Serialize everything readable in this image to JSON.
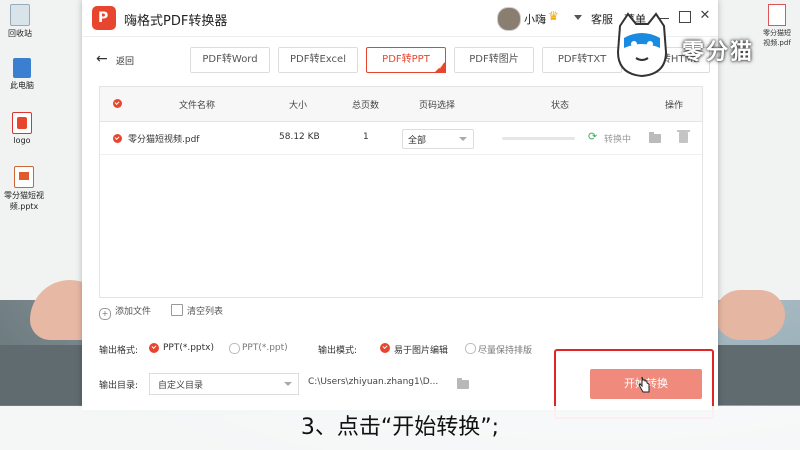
{
  "desktop": {
    "icons": [
      {
        "label": "回收站"
      },
      {
        "label": "此电脑"
      },
      {
        "label": "logo"
      },
      {
        "label": "零分猫短视频.pptx"
      }
    ],
    "pdf_file_label": "零分猫短视频.pdf"
  },
  "app": {
    "title": "嗨格式PDF转换器",
    "username": "小嗨",
    "service": "客服",
    "menu": "菜单",
    "back_label": "返回",
    "tabs": [
      {
        "label": "PDF转Word",
        "active": false
      },
      {
        "label": "PDF转Excel",
        "active": false
      },
      {
        "label": "PDF转PPT",
        "active": true
      },
      {
        "label": "PDF转图片",
        "active": false
      },
      {
        "label": "PDF转TXT",
        "active": false
      },
      {
        "label": "PDF转HTML",
        "active": false
      }
    ],
    "table": {
      "headers": {
        "name": "文件名称",
        "size": "大小",
        "pages": "总页数",
        "page_select": "页码选择",
        "status": "状态",
        "action": "操作"
      },
      "rows": [
        {
          "name": "零分猫短视频.pdf",
          "size": "58.12 KB",
          "pages": "1",
          "page_select": "全部",
          "progress": 0.0,
          "status": "转换中"
        }
      ]
    },
    "add_file": "添加文件",
    "clear_list": "清空列表",
    "output_format_label": "输出格式:",
    "format_options": [
      {
        "label": "PPT(*.pptx)",
        "selected": true
      },
      {
        "label": "PPT(*.ppt)",
        "selected": false
      }
    ],
    "output_mode_label": "输出模式:",
    "mode_options": [
      {
        "label": "易于图片编辑",
        "selected": true
      },
      {
        "label": "尽量保持排版",
        "selected": false
      }
    ],
    "output_dir_label": "输出目录:",
    "output_dir_select": "自定义目录",
    "output_dir_path": "C:\\Users\\zhiyuan.zhang1\\D...",
    "start_button": "开始转换"
  },
  "brand": {
    "text": "零分猫"
  },
  "caption": "3、点击“开始转换”;",
  "colors": {
    "accent": "#e8452f",
    "start_button": "#f08a7c",
    "highlight": "#e02525"
  }
}
